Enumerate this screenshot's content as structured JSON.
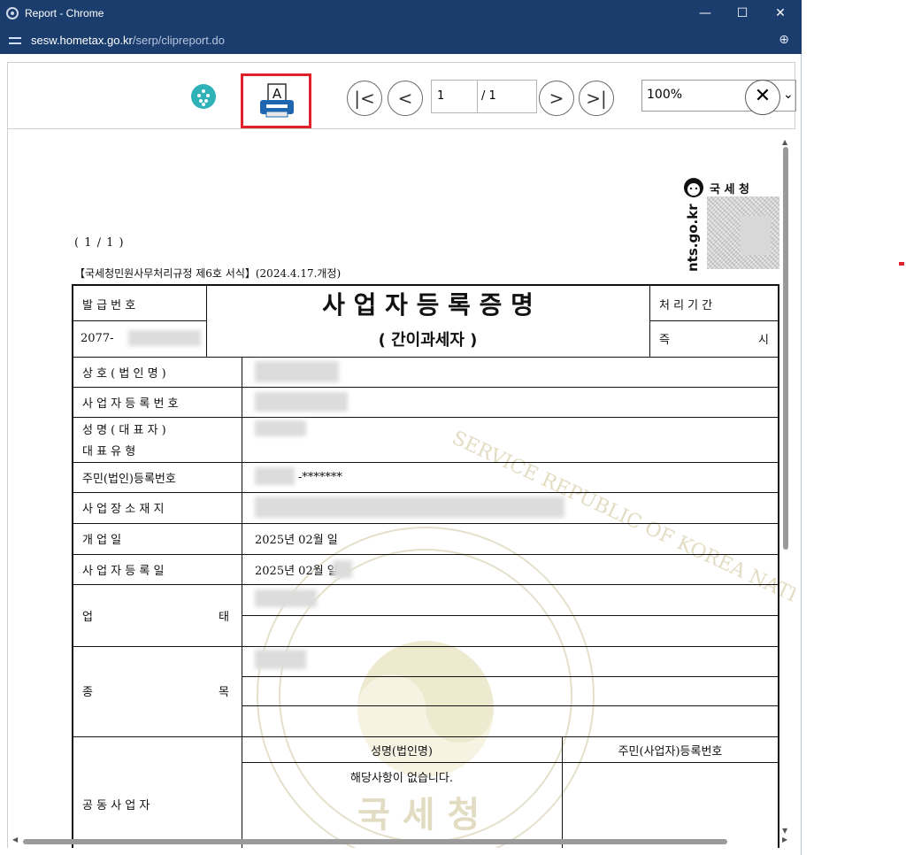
{
  "window": {
    "title": "Report - Chrome",
    "min_glyph": "—",
    "max_glyph": "☐",
    "close_glyph": "✕"
  },
  "address": {
    "host": "sesw.hometax.go.kr",
    "path": "/serp/clipreport.do",
    "zoom_glyph": "⊕"
  },
  "toolbar": {
    "first_glyph": "|<",
    "prev_glyph": "<",
    "next_glyph": ">",
    "last_glyph": ">|",
    "page_current": "1",
    "page_total": "/ 1",
    "zoom_value": "100%",
    "zoom_clear_glyph": "✕",
    "zoom_chevron": "⌄"
  },
  "doc": {
    "agency_name": "국 세 청",
    "site": "nts.go.kr",
    "page_indicator": "(   1 / 1   )",
    "form_number": "【국세청민원사무처리규정 제6호 서식】(2024.4.17.개정)",
    "title": "사 업 자 등 록 증 명",
    "subtitle": "( 간이과세자 )",
    "issue_label": "발 급 번 호",
    "issue_value": "2077-",
    "process_label": "처 리 기 간",
    "process_value_left": "즉",
    "process_value_right": "시",
    "rows": {
      "company": "상 호 ( 법 인 명 )",
      "biz_no": "사 업 자 등 록 번 호",
      "name_line1": "성 명 ( 대 표 자 )",
      "name_line2": "대 표 유 형",
      "resident": "주민(법인)등록번호",
      "resident_value": "-*******",
      "address": "사 업 장 소 재 지",
      "open_label": "개       업       일",
      "open_value": "2025년 02월      일",
      "reg_label": "사 업 자 등 록 일",
      "reg_value": "2025년 02월      일",
      "type_left": "업",
      "type_right": "태",
      "item_left": "종",
      "item_right": "목",
      "co_owner": "공 동 사 업 자",
      "co_name_header": "성명(법인명)",
      "co_reg_header": "주민(사업자)등록번호",
      "co_none": "해당사항이 없습니다."
    },
    "watermark": {
      "ring_text": "SERVICE REPUBLIC OF KOREA NATIONAL",
      "name": "국 세 청"
    }
  }
}
